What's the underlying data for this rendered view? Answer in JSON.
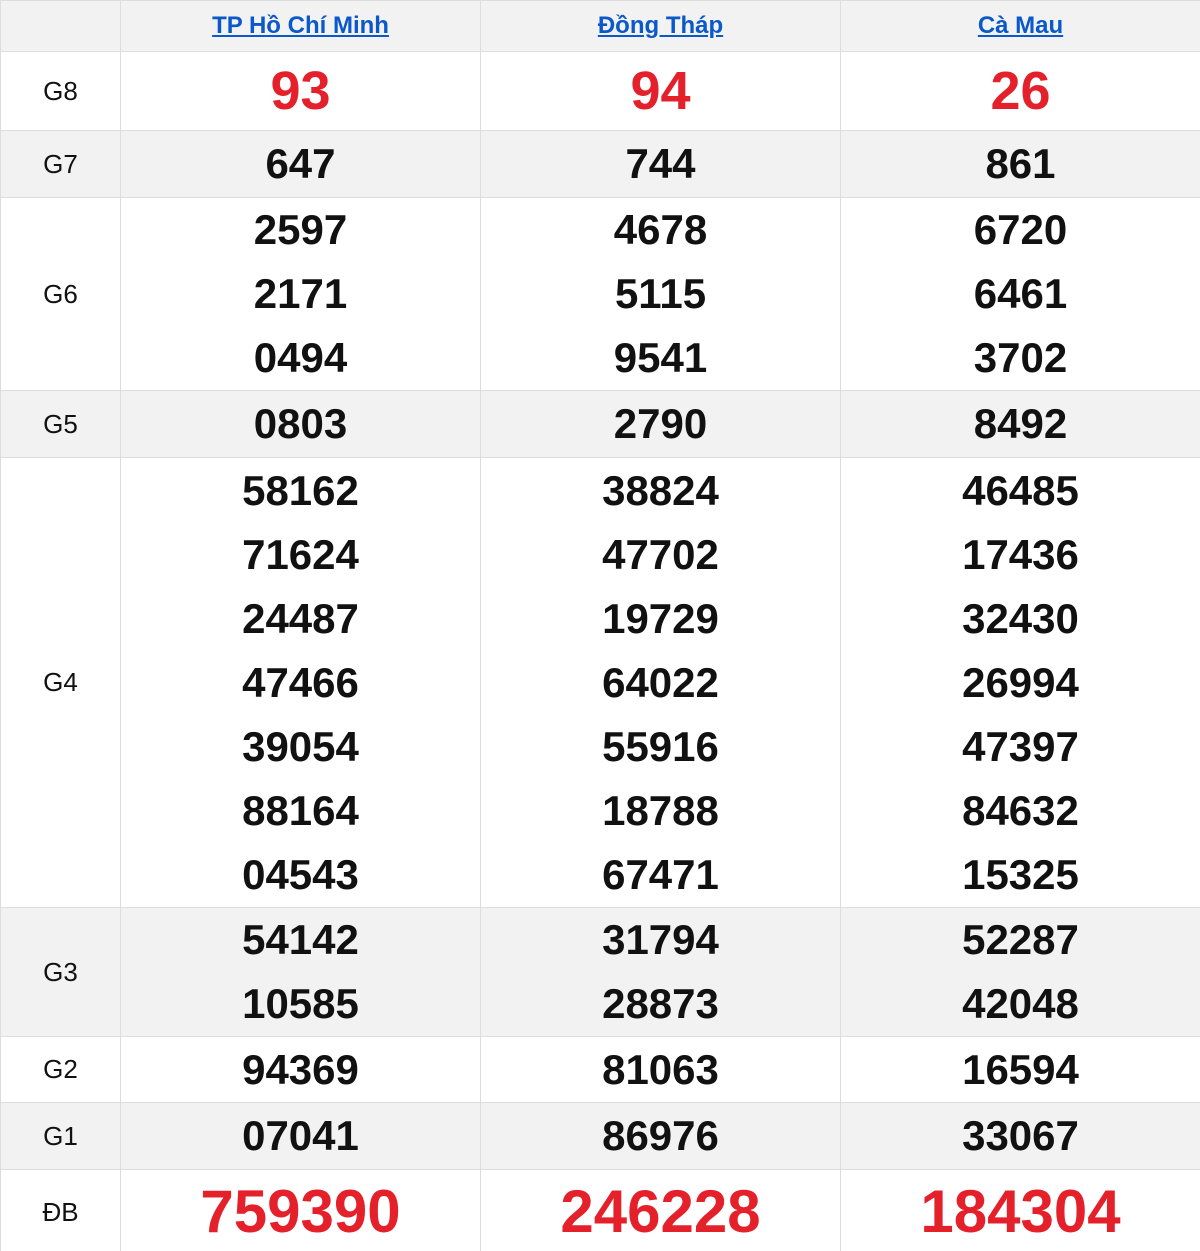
{
  "provinces": [
    "TP Hồ Chí Minh",
    "Đồng Tháp",
    "Cà Mau"
  ],
  "prizes": [
    {
      "label": "G8",
      "values": [
        [
          "93"
        ],
        [
          "94"
        ],
        [
          "26"
        ]
      ]
    },
    {
      "label": "G7",
      "values": [
        [
          "647"
        ],
        [
          "744"
        ],
        [
          "861"
        ]
      ]
    },
    {
      "label": "G6",
      "values": [
        [
          "2597",
          "2171",
          "0494"
        ],
        [
          "4678",
          "5115",
          "9541"
        ],
        [
          "6720",
          "6461",
          "3702"
        ]
      ]
    },
    {
      "label": "G5",
      "values": [
        [
          "0803"
        ],
        [
          "2790"
        ],
        [
          "8492"
        ]
      ]
    },
    {
      "label": "G4",
      "values": [
        [
          "58162",
          "71624",
          "24487",
          "47466",
          "39054",
          "88164",
          "04543"
        ],
        [
          "38824",
          "47702",
          "19729",
          "64022",
          "55916",
          "18788",
          "67471"
        ],
        [
          "46485",
          "17436",
          "32430",
          "26994",
          "47397",
          "84632",
          "15325"
        ]
      ]
    },
    {
      "label": "G3",
      "values": [
        [
          "54142",
          "10585"
        ],
        [
          "31794",
          "28873"
        ],
        [
          "52287",
          "42048"
        ]
      ]
    },
    {
      "label": "G2",
      "values": [
        [
          "94369"
        ],
        [
          "81063"
        ],
        [
          "16594"
        ]
      ]
    },
    {
      "label": "G1",
      "values": [
        [
          "07041"
        ],
        [
          "86976"
        ],
        [
          "33067"
        ]
      ]
    },
    {
      "label": "ĐB",
      "values": [
        [
          "759390"
        ],
        [
          "246228"
        ],
        [
          "184304"
        ]
      ]
    }
  ],
  "colors": {
    "highlight": "#e4202a",
    "link": "#0a58ca",
    "shade": "#f2f2f2"
  }
}
